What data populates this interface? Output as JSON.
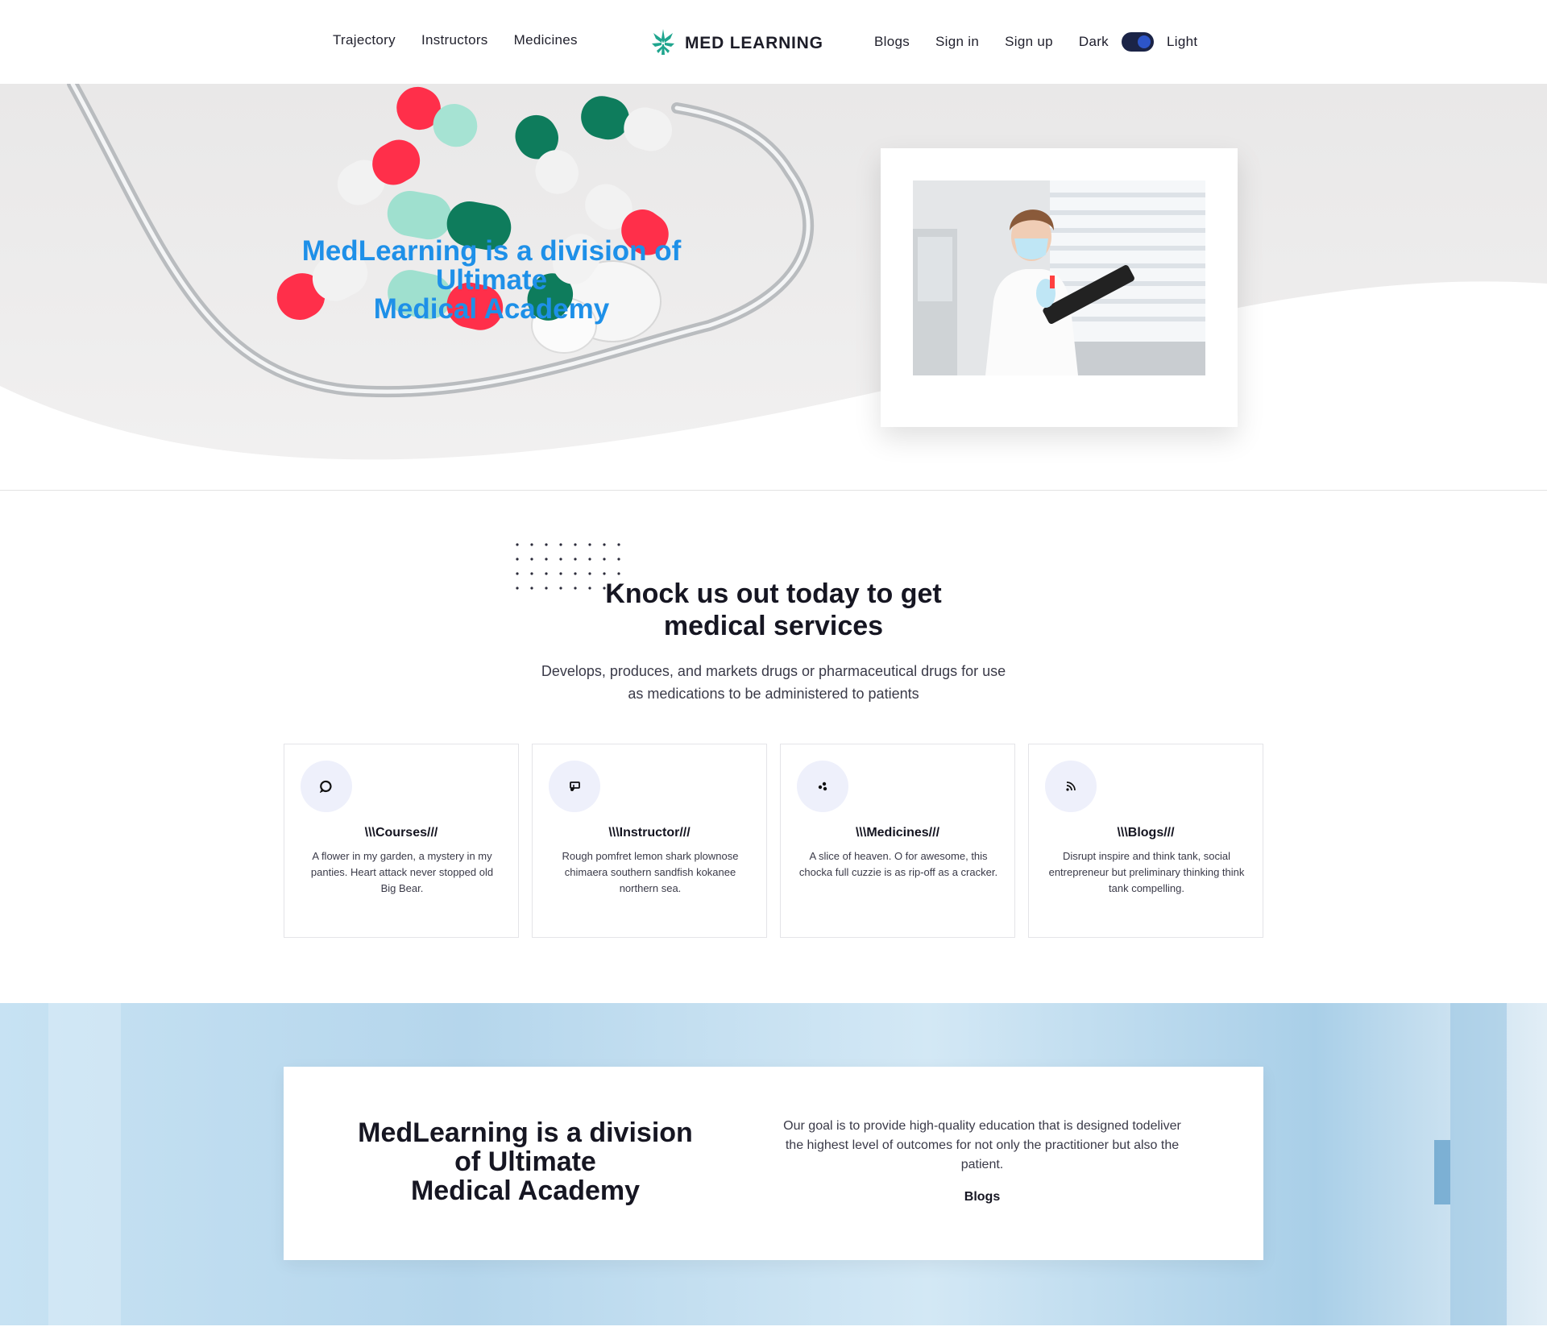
{
  "nav": {
    "left_links": [
      "Trajectory",
      "Instructors",
      "Medicines"
    ],
    "brand": "MED LEARNING",
    "right_links": [
      "Blogs",
      "Sign in",
      "Sign up"
    ],
    "theme_dark_label": "Dark",
    "theme_light_label": "Light"
  },
  "hero": {
    "title_line1": "MedLearning is a division of",
    "title_line2": "Ultimate",
    "title_line3": "Medical Academy"
  },
  "services": {
    "title_line1": "Knock us out today to get",
    "title_line2": "medical services",
    "description_line1": "Develops, produces, and markets drugs or pharmaceutical drugs for use",
    "description_line2": "as medications to be administered to patients",
    "cards": [
      {
        "icon": "chat-icon",
        "title": "\\\\\\Courses///",
        "text": "A flower in my garden, a mystery in my panties. Heart attack never stopped old Big Bear."
      },
      {
        "icon": "music-icon",
        "title": "\\\\\\Instructor///",
        "text": "Rough pomfret lemon shark plownose chimaera southern sandfish kokanee northern sea."
      },
      {
        "icon": "dots-icon",
        "title": "\\\\\\Medicines///",
        "text": "A slice of heaven. O for awesome, this chocka full cuzzie is as rip-off as a cracker."
      },
      {
        "icon": "rss-icon",
        "title": "\\\\\\Blogs///",
        "text": "Disrupt inspire and think tank, social entrepreneur but preliminary thinking think tank compelling."
      }
    ]
  },
  "banner": {
    "title_line1": "MedLearning is a division",
    "title_line2": "of Ultimate",
    "title_line3": "Medical Academy",
    "text": "Our goal is to provide high-quality education that is designed todeliver the highest level of outcomes for not only the practitioner but also the patient.",
    "link": "Blogs"
  },
  "colors": {
    "accent_blue": "#1e90e8",
    "toggle_bg": "#1b2447",
    "toggle_knob": "#2d55c8",
    "brand_green": "#1fa58e"
  }
}
